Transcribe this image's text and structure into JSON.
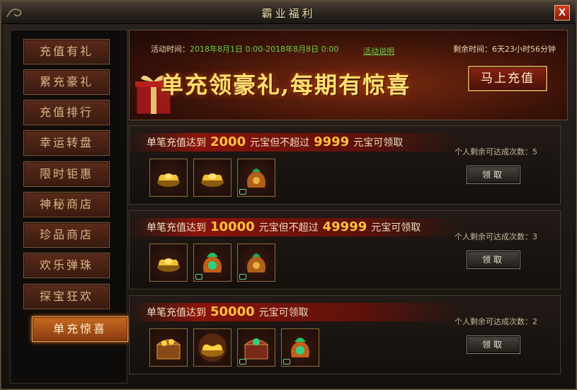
{
  "window": {
    "title": "霸业福利",
    "close_label": "X"
  },
  "sidebar": {
    "items": [
      {
        "label": "充值有礼",
        "active": false
      },
      {
        "label": "累充豪礼",
        "active": false
      },
      {
        "label": "充值排行",
        "active": false
      },
      {
        "label": "幸运转盘",
        "active": false
      },
      {
        "label": "限时钜惠",
        "active": false
      },
      {
        "label": "神秘商店",
        "active": false
      },
      {
        "label": "珍品商店",
        "active": false
      },
      {
        "label": "欢乐弹珠",
        "active": false
      },
      {
        "label": "探宝狂欢",
        "active": false
      },
      {
        "label": "单充惊喜",
        "active": true
      }
    ]
  },
  "banner": {
    "activity_label": "活动时间：",
    "activity_time": "2018年8月1日 0:00-2018年8月8日 0:00",
    "rules_link": "活动说明",
    "remaining": "剩余时间：6天23小时56分钟",
    "slogan": "单充领豪礼,每期有惊喜",
    "recharge_button": "马上充值"
  },
  "tiers": [
    {
      "req_prefix": "单笔充值达到",
      "min": "2000",
      "req_mid": "元宝但不超过",
      "max": "9999",
      "req_suffix": "元宝可领取",
      "remain_label": "个人剩余可达成次数：",
      "remain_count": "5",
      "claim_label": "领取",
      "items": [
        "gold-ingot-icon",
        "gold-ingot-icon",
        "treasure-bag-icon"
      ]
    },
    {
      "req_prefix": "单笔充值达到",
      "min": "10000",
      "req_mid": "元宝但不超过",
      "max": "49999",
      "req_suffix": "元宝可领取",
      "remain_label": "个人剩余可达成次数：",
      "remain_count": "3",
      "claim_label": "领取",
      "items": [
        "gold-ingot-icon",
        "jade-treasure-bag-icon",
        "treasure-bag-icon"
      ]
    },
    {
      "req_prefix": "单笔充值达到",
      "min": "50000",
      "req_suffix": "元宝可领取",
      "remain_label": "个人剩余可达成次数：",
      "remain_count": "2",
      "claim_label": "领取",
      "items": [
        "treasure-chest-icon",
        "glowing-gold-ingot-icon",
        "jade-treasure-chest-icon",
        "jade-treasure-bag-icon"
      ]
    }
  ]
}
